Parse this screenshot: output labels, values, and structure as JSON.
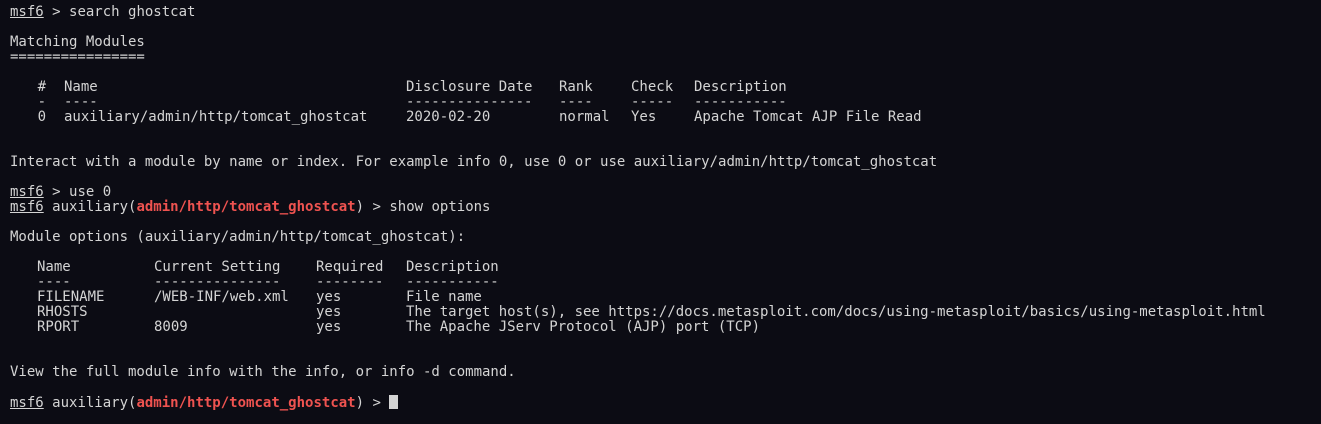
{
  "prompt": {
    "user": "msf6",
    "sep": " > ",
    "module_prefix": "auxiliary(",
    "module": "admin/http/tomcat_ghostcat",
    "module_suffix": ")"
  },
  "commands": {
    "search": "search ghostcat",
    "use": "use 0",
    "show": "show options"
  },
  "search_results": {
    "title": "Matching Modules",
    "underline": "================",
    "headers": {
      "idx": "#",
      "name": "Name",
      "date": "Disclosure Date",
      "rank": "Rank",
      "check": "Check",
      "desc": "Description"
    },
    "dashes": {
      "idx": "-",
      "name": "----",
      "date": "---------------",
      "rank": "----",
      "check": "-----",
      "desc": "-----------"
    },
    "rows": [
      {
        "idx": "0",
        "name": "auxiliary/admin/http/tomcat_ghostcat",
        "date": "2020-02-20",
        "rank": "normal",
        "check": "Yes",
        "desc": "Apache Tomcat AJP File Read"
      }
    ],
    "hint": "Interact with a module by name or index. For example info 0, use 0 or use auxiliary/admin/http/tomcat_ghostcat"
  },
  "options": {
    "title": "Module options (auxiliary/admin/http/tomcat_ghostcat):",
    "headers": {
      "name": "Name",
      "current": "Current Setting",
      "required": "Required",
      "desc": "Description"
    },
    "dashes": {
      "name": "----",
      "current": "---------------",
      "required": "--------",
      "desc": "-----------"
    },
    "rows": [
      {
        "name": "FILENAME",
        "current": "/WEB-INF/web.xml",
        "required": "yes",
        "desc": "File name"
      },
      {
        "name": "RHOSTS",
        "current": "",
        "required": "yes",
        "desc": "The target host(s), see https://docs.metasploit.com/docs/using-metasploit/basics/using-metasploit.html"
      },
      {
        "name": "RPORT",
        "current": "8009",
        "required": "yes",
        "desc": "The Apache JServ Protocol (AJP) port (TCP)"
      }
    ],
    "footer": "View the full module info with the info, or info -d command."
  },
  "colors": {
    "background": "#0c0c14",
    "text": "#d4d4d4",
    "module_highlight": "#ef5350"
  }
}
